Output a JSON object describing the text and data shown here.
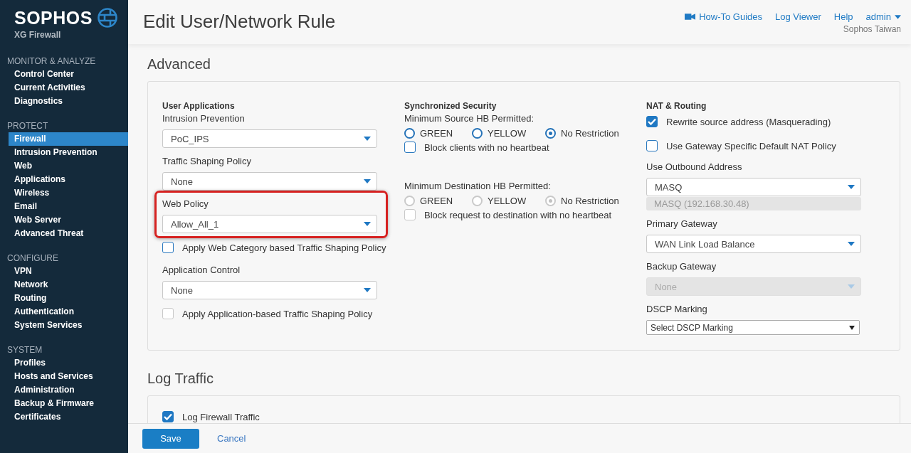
{
  "sidebar": {
    "logo": {
      "brand": "SOPHOS",
      "product": "XG Firewall"
    },
    "sections": [
      {
        "title": "MONITOR & ANALYZE",
        "items": [
          {
            "label": "Control Center",
            "selected": false
          },
          {
            "label": "Current Activities",
            "selected": false
          },
          {
            "label": "Diagnostics",
            "selected": false
          }
        ]
      },
      {
        "title": "PROTECT",
        "items": [
          {
            "label": "Firewall",
            "selected": true
          },
          {
            "label": "Intrusion Prevention",
            "selected": false
          },
          {
            "label": "Web",
            "selected": false
          },
          {
            "label": "Applications",
            "selected": false
          },
          {
            "label": "Wireless",
            "selected": false
          },
          {
            "label": "Email",
            "selected": false
          },
          {
            "label": "Web Server",
            "selected": false
          },
          {
            "label": "Advanced Threat",
            "selected": false
          }
        ]
      },
      {
        "title": "CONFIGURE",
        "items": [
          {
            "label": "VPN",
            "selected": false
          },
          {
            "label": "Network",
            "selected": false
          },
          {
            "label": "Routing",
            "selected": false
          },
          {
            "label": "Authentication",
            "selected": false
          },
          {
            "label": "System Services",
            "selected": false
          }
        ]
      },
      {
        "title": "SYSTEM",
        "items": [
          {
            "label": "Profiles",
            "selected": false
          },
          {
            "label": "Hosts and Services",
            "selected": false
          },
          {
            "label": "Administration",
            "selected": false
          },
          {
            "label": "Backup & Firmware",
            "selected": false
          },
          {
            "label": "Certificates",
            "selected": false
          }
        ]
      }
    ]
  },
  "header": {
    "title": "Edit User/Network Rule",
    "links": [
      {
        "label": "How-To Guides",
        "kind": "video"
      },
      {
        "label": "Log Viewer",
        "kind": "plain"
      },
      {
        "label": "Help",
        "kind": "plain"
      },
      {
        "label": "admin",
        "kind": "menu"
      }
    ],
    "organization": "Sophos Taiwan"
  },
  "sections": [
    {
      "title": "Advanced",
      "columns": [
        {
          "fields": [
            {
              "kind": "heading",
              "label": "User Applications"
            },
            {
              "kind": "select",
              "label": "Intrusion Prevention",
              "value": "PoC_IPS",
              "disabled": false,
              "highlighted": false
            },
            {
              "kind": "select",
              "label": "Traffic Shaping Policy",
              "value": "None",
              "disabled": false,
              "highlighted": false
            },
            {
              "kind": "select",
              "label": "Web Policy",
              "value": "Allow_All_1",
              "disabled": false,
              "highlighted": true
            },
            {
              "kind": "checkbox",
              "label": "Apply Web Category based Traffic Shaping Policy",
              "checked": false,
              "disabled": false
            },
            {
              "kind": "select",
              "label": "Application Control",
              "value": "None",
              "disabled": false,
              "highlighted": false
            },
            {
              "kind": "checkbox",
              "label": "Apply Application-based Traffic Shaping Policy",
              "checked": false,
              "disabled": true
            }
          ]
        },
        {
          "fields": [
            {
              "kind": "heading",
              "label": "Synchronized Security"
            },
            {
              "kind": "radio-group",
              "label": "Minimum Source HB Permitted:",
              "disabled": false,
              "options": [
                {
                  "label": "GREEN",
                  "selected": false
                },
                {
                  "label": "YELLOW",
                  "selected": false
                },
                {
                  "label": "No Restriction",
                  "selected": true
                }
              ]
            },
            {
              "kind": "checkbox",
              "label": "Block clients with no heartbeat",
              "checked": false,
              "disabled": false
            },
            {
              "kind": "radio-group",
              "label": "Minimum Destination HB Permitted:",
              "disabled": true,
              "options": [
                {
                  "label": "GREEN",
                  "selected": false
                },
                {
                  "label": "YELLOW",
                  "selected": false
                },
                {
                  "label": "No Restriction",
                  "selected": true
                }
              ]
            },
            {
              "kind": "checkbox",
              "label": "Block request to destination with no heartbeat",
              "checked": false,
              "disabled": true
            }
          ]
        },
        {
          "fields": [
            {
              "kind": "heading",
              "label": "NAT & Routing"
            },
            {
              "kind": "checkbox",
              "label": "Rewrite source address (Masquerading)",
              "checked": true,
              "disabled": false
            },
            {
              "kind": "checkbox",
              "label": "Use Gateway Specific Default NAT Policy",
              "checked": false,
              "disabled": false
            },
            {
              "kind": "select",
              "label": "Use Outbound Address",
              "value": "MASQ",
              "note": "MASQ (192.168.30.48)",
              "disabled": false,
              "highlighted": false
            },
            {
              "kind": "select",
              "label": "Primary Gateway",
              "value": "WAN Link Load Balance",
              "disabled": false,
              "highlighted": false
            },
            {
              "kind": "select",
              "label": "Backup Gateway",
              "value": "None",
              "disabled": true,
              "highlighted": false
            },
            {
              "kind": "native-select",
              "label": "DSCP Marking",
              "value": "Select DSCP Marking"
            }
          ]
        }
      ]
    },
    {
      "title": "Log Traffic",
      "columns": [
        {
          "fields": [
            {
              "kind": "checkbox",
              "label": "Log Firewall Traffic",
              "checked": true,
              "disabled": false
            }
          ]
        }
      ]
    }
  ],
  "footer": {
    "buttons": [
      {
        "label": "Save",
        "kind": "primary"
      },
      {
        "label": "Cancel",
        "kind": "link"
      }
    ]
  }
}
